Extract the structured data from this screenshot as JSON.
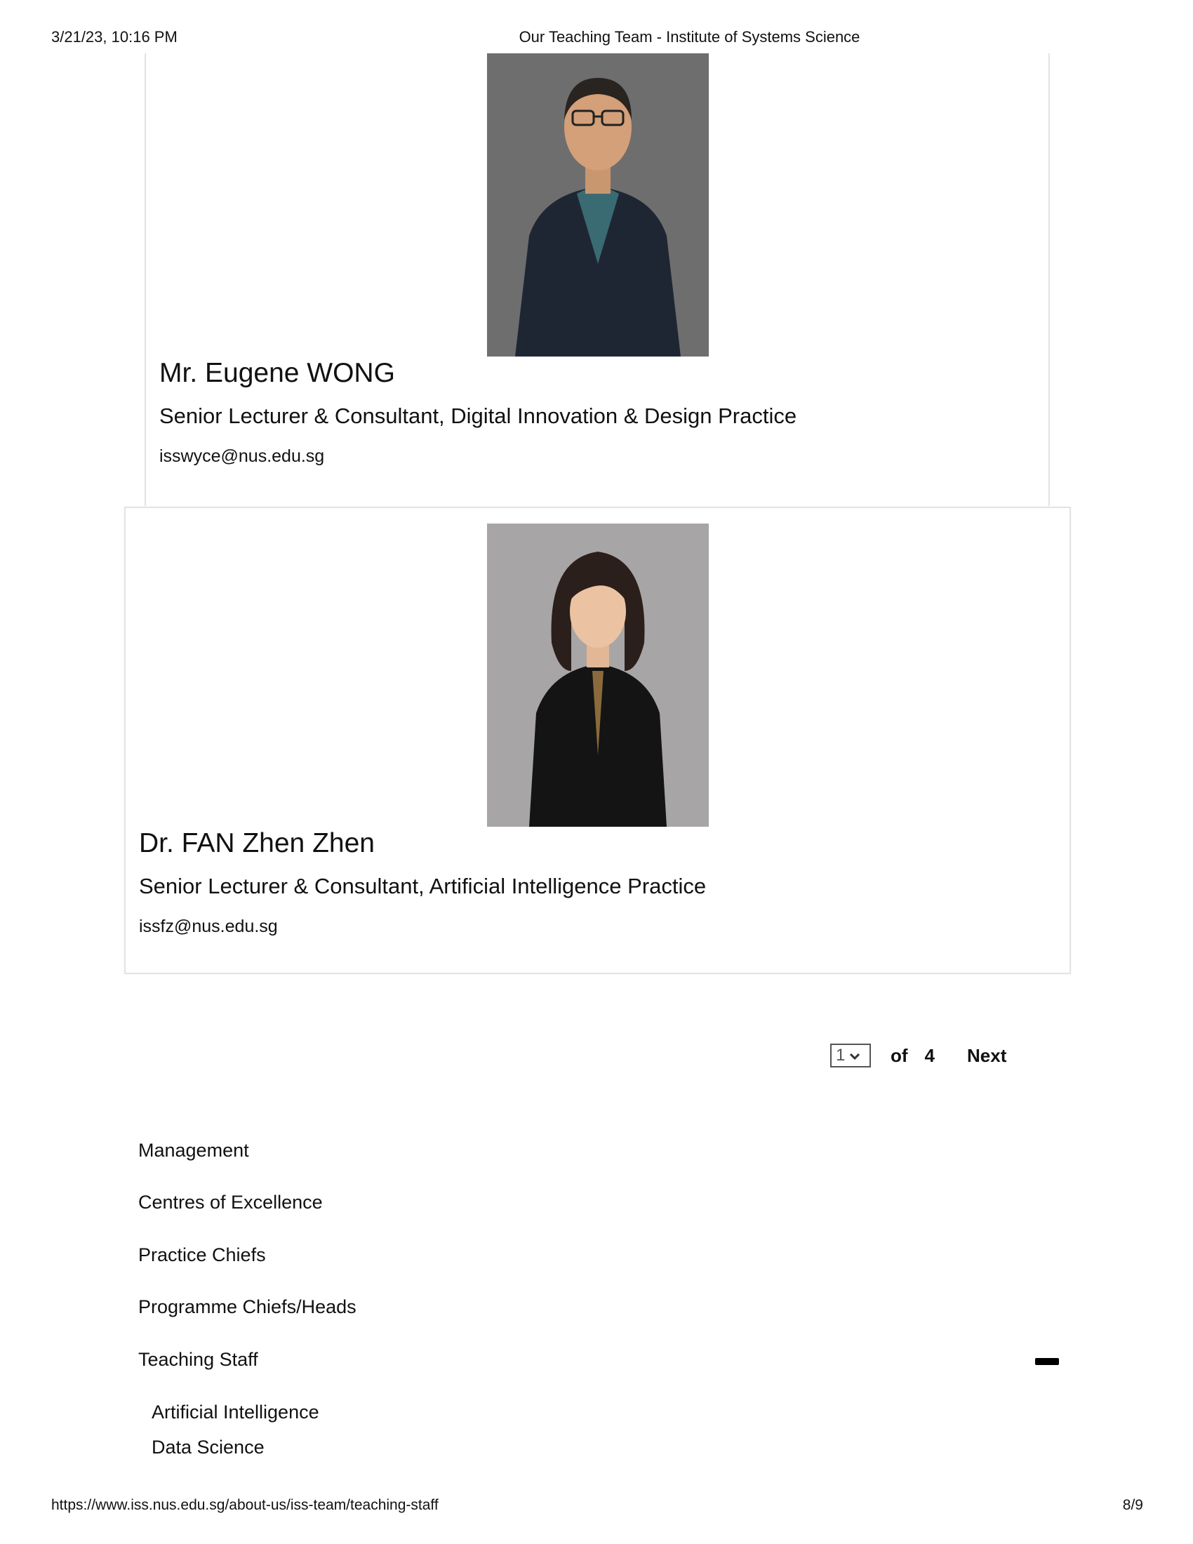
{
  "print_header": {
    "datetime": "3/21/23, 10:16 PM",
    "title": "Our Teaching Team - Institute of Systems Science"
  },
  "staff": [
    {
      "name": "Mr. Eugene WONG",
      "role": "Senior Lecturer & Consultant, Digital Innovation & Design Practice",
      "email": "isswyce@nus.edu.sg"
    },
    {
      "name": "Dr. FAN Zhen Zhen",
      "role": "Senior Lecturer & Consultant, Artificial Intelligence Practice",
      "email": "issfz@nus.edu.sg"
    }
  ],
  "pagination": {
    "current": "1",
    "of_label": "of",
    "total": "4",
    "next_label": "Next"
  },
  "nav": {
    "items": [
      "Management",
      "Centres of Excellence",
      "Practice Chiefs",
      "Programme Chiefs/Heads",
      "Teaching Staff"
    ],
    "sub_items": [
      "Artificial Intelligence",
      "Data Science"
    ]
  },
  "print_footer": {
    "url": "https://www.iss.nus.edu.sg/about-us/iss-team/teaching-staff",
    "page": "8/9"
  }
}
